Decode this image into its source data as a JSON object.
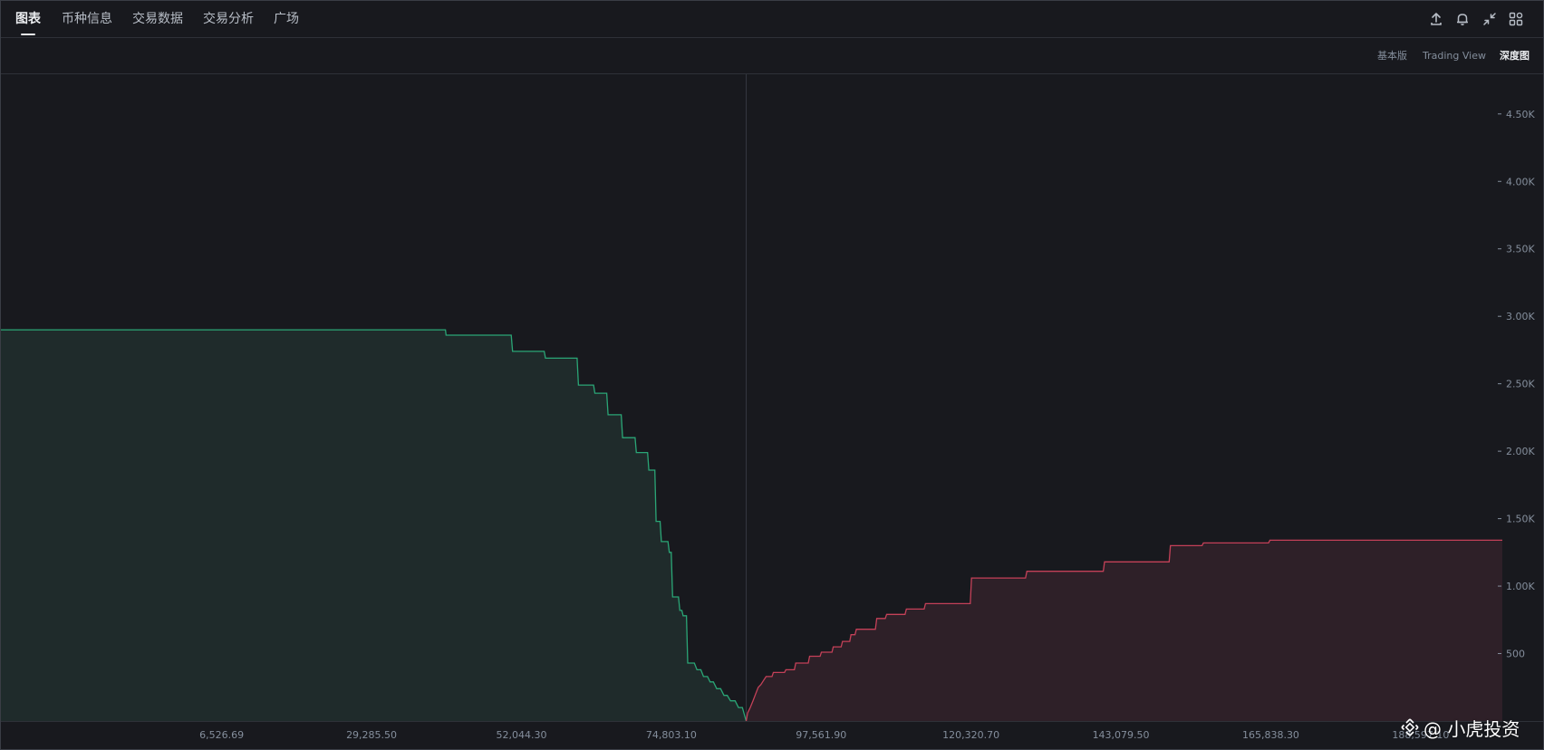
{
  "nav": {
    "tabs": [
      {
        "label": "图表",
        "active": true
      },
      {
        "label": "币种信息",
        "active": false
      },
      {
        "label": "交易数据",
        "active": false
      },
      {
        "label": "交易分析",
        "active": false
      },
      {
        "label": "广场",
        "active": false
      }
    ],
    "icons": [
      "upload-icon",
      "bell-icon",
      "collapse-icon",
      "apps-grid-icon"
    ]
  },
  "views": {
    "options": [
      {
        "label": "基本版",
        "active": false
      },
      {
        "label": "Trading View",
        "active": false
      },
      {
        "label": "深度图",
        "active": true
      }
    ]
  },
  "colors": {
    "bid": "#2ebd85",
    "bid_fill": "#1f2b2b",
    "ask": "#e04862",
    "ask_fill": "#2e2028",
    "background": "#18191e"
  },
  "watermark": {
    "text": "@ 小虎投资"
  },
  "chart_data": {
    "type": "area",
    "title": "",
    "xlabel": "",
    "ylabel": "",
    "x_ticks": [
      "6,526.69",
      "29,285.50",
      "52,044.30",
      "74,803.10",
      "97,561.90",
      "120,320.70",
      "143,079.50",
      "165,838.30",
      "188,597.10"
    ],
    "x_tick_values": [
      6526.69,
      29285.5,
      52044.3,
      74803.1,
      97561.9,
      120320.7,
      143079.5,
      165838.3,
      188597.1
    ],
    "y_ticks": [
      "500",
      "1.00K",
      "1.50K",
      "2.00K",
      "2.50K",
      "3.00K",
      "3.50K",
      "4.00K",
      "4.50K"
    ],
    "y_tick_values": [
      500,
      1000,
      1500,
      2000,
      2500,
      3000,
      3500,
      4000,
      4500
    ],
    "xlim": [
      -27000,
      201000
    ],
    "ylim": [
      0,
      4700
    ],
    "mid_price": 86180,
    "series": [
      {
        "side": "bids",
        "x": [
          -27000,
          40500,
          40600,
          50500,
          50700,
          55500,
          55700,
          60500,
          60700,
          63000,
          63200,
          65000,
          65200,
          67200,
          67400,
          69300,
          69500,
          71200,
          71400,
          72300,
          72500,
          73100,
          73300,
          74300,
          74500,
          74800,
          75000,
          75900,
          76100,
          76400,
          76600,
          77100,
          77300,
          78300,
          78700,
          79300,
          79700,
          80300,
          80700,
          81200,
          81700,
          82300,
          82800,
          83300,
          83800,
          84500,
          85000,
          85600,
          86180
        ],
        "y": [
          2900,
          2900,
          2860,
          2860,
          2740,
          2740,
          2690,
          2690,
          2490,
          2490,
          2430,
          2430,
          2270,
          2270,
          2100,
          2100,
          1990,
          1990,
          1860,
          1860,
          1480,
          1480,
          1330,
          1330,
          1250,
          1250,
          920,
          920,
          820,
          820,
          780,
          780,
          430,
          430,
          380,
          380,
          330,
          330,
          290,
          290,
          240,
          240,
          190,
          190,
          150,
          150,
          100,
          100,
          0
        ]
      },
      {
        "side": "asks",
        "x": [
          86180,
          86400,
          86800,
          87200,
          87600,
          88000,
          88400,
          88800,
          89200,
          90100,
          90300,
          92000,
          92200,
          93500,
          93700,
          95600,
          95800,
          97400,
          97600,
          99200,
          99400,
          100600,
          100800,
          101900,
          102100,
          102700,
          102900,
          105800,
          106000,
          107300,
          107500,
          110300,
          110500,
          113200,
          113400,
          120200,
          120400,
          128600,
          128800,
          140400,
          140600,
          150400,
          150600,
          155400,
          155600,
          165500,
          165700,
          201000
        ],
        "y": [
          0,
          60,
          100,
          150,
          200,
          250,
          270,
          300,
          330,
          330,
          360,
          360,
          380,
          380,
          430,
          430,
          480,
          480,
          510,
          510,
          550,
          550,
          590,
          590,
          640,
          640,
          680,
          680,
          760,
          760,
          790,
          790,
          830,
          830,
          870,
          870,
          1060,
          1060,
          1110,
          1110,
          1180,
          1180,
          1300,
          1300,
          1320,
          1320,
          1340,
          1340
        ]
      }
    ],
    "grid": false,
    "legend": "none"
  }
}
